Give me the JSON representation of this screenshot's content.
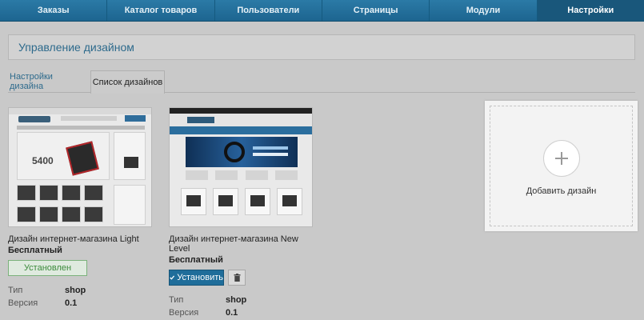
{
  "topnav": {
    "items": [
      {
        "label": "Заказы"
      },
      {
        "label": "Каталог товаров"
      },
      {
        "label": "Пользователи"
      },
      {
        "label": "Страницы"
      },
      {
        "label": "Модули"
      },
      {
        "label": "Настройки"
      }
    ],
    "active_index": 5
  },
  "header": {
    "title": "Управление дизайном"
  },
  "tabs": [
    {
      "label": "Настройки дизайна"
    },
    {
      "label": "Список дизайнов",
      "selected": true
    }
  ],
  "designs": [
    {
      "thumb_price": "5400",
      "name": "Дизайн интернет-магазина Light",
      "price": "Бесплатный",
      "installed_label": "Установлен",
      "type_label": "Тип",
      "type_value": "shop",
      "version_label": "Версия",
      "version_value": "0.1"
    },
    {
      "name": "Дизайн интернет-магазина New Level",
      "price": "Бесплатный",
      "install_label": "Установить",
      "type_label": "Тип",
      "type_value": "shop",
      "version_label": "Версия",
      "version_value": "0.1"
    }
  ],
  "add_design": {
    "label": "Добавить дизайн"
  },
  "colors": {
    "nav": "#1d6590",
    "link": "#2d6a8c",
    "install_button": "#1f6d9a",
    "installed_border": "#7bb27b"
  },
  "icons": {
    "checkmark": "check-icon",
    "trash": "trash-icon",
    "plus": "plus-icon"
  }
}
